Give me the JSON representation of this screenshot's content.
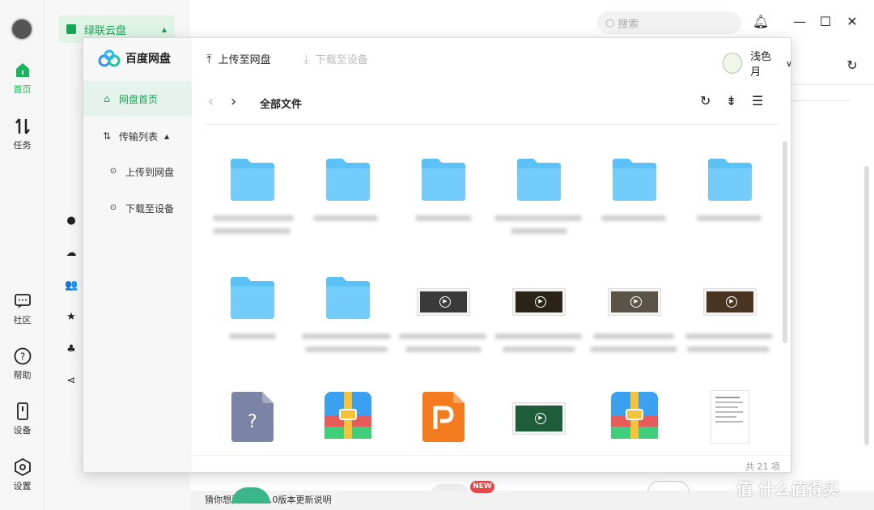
{
  "rail": {
    "items": [
      {
        "label": "首页"
      },
      {
        "label": "任务"
      },
      {
        "label": "社区"
      },
      {
        "label": "帮助"
      },
      {
        "label": "设备"
      },
      {
        "label": "设置"
      }
    ]
  },
  "sidebar": {
    "cloud_label": "绿联云盘"
  },
  "header": {
    "search_placeholder": "搜索"
  },
  "footer": {
    "text": "猜你想要：V3.2.0版本更新说明",
    "new_badge": "NEW"
  },
  "baidu": {
    "app_name": "百度网盘",
    "nav": [
      {
        "label": "网盘首页"
      },
      {
        "label": "传输列表"
      },
      {
        "label": "上传到网盘"
      },
      {
        "label": "下载至设备"
      }
    ],
    "toolbar": {
      "upload": "上传至网盘",
      "download": "下载至设备"
    },
    "user": {
      "name": "浅色月"
    },
    "path": {
      "current": "全部文件"
    },
    "status": {
      "count": "共 21 项"
    }
  },
  "watermark": "值 什么值得买",
  "colors": {
    "accent": "#17b65c",
    "folder": "#5cc1f7"
  }
}
